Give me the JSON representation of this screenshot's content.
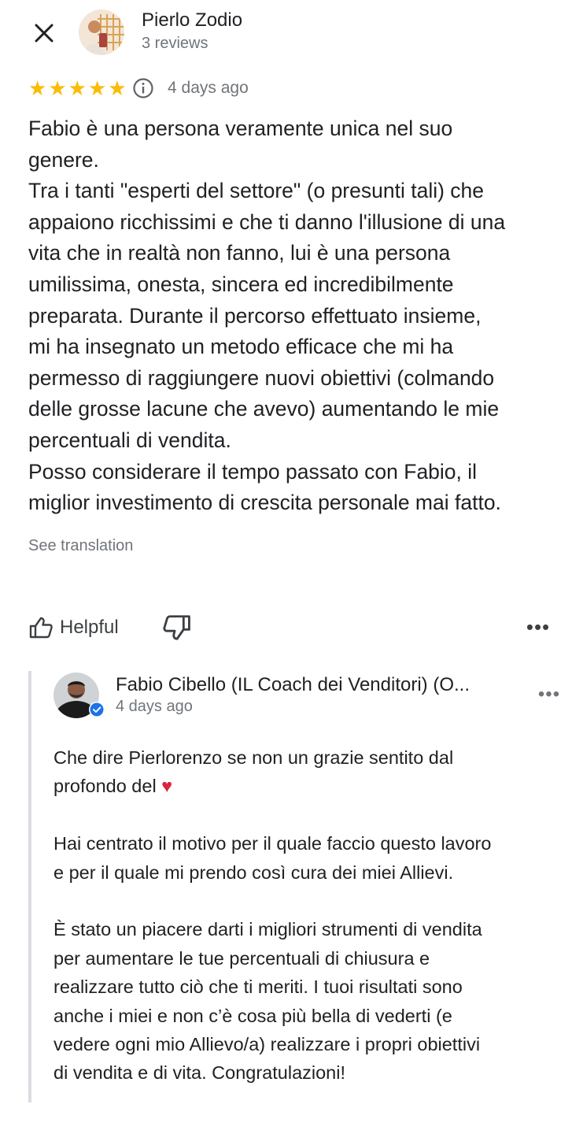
{
  "header": {
    "close_icon": "close-icon",
    "reviewer_name": "Pierlo Zodio",
    "reviewer_reviews": "3 reviews"
  },
  "review": {
    "rating": 5,
    "rating_max": 5,
    "star_color": "#fbbc04",
    "date": "4 days ago",
    "text": "Fabio è una persona veramente unica nel suo\ngenere.\nTra i tanti \"esperti del settore\" (o presunti tali) che\nappaiono ricchissimi e che ti danno l'illusione di una\nvita che in realtà non fanno, lui è una persona\numilissima, onesta, sincera ed incredibilmente\npreparata. Durante il percorso effettuato insieme,\nmi ha insegnato un metodo efficace che mi ha\npermesso di raggiungere nuovi obiettivi (colmando\ndelle grosse lacune che avevo) aumentando le mie\npercentuali di vendita.\nPosso considerare il tempo passato con Fabio, il\nmiglior investimento di crescita personale mai fatto.",
    "see_translation": "See translation"
  },
  "actions": {
    "helpful_label": "Helpful",
    "helpful_icon": "thumbs-up-icon",
    "not_helpful_icon": "thumbs-down-icon",
    "more_icon": "more-horiz-icon"
  },
  "owner_reply": {
    "name": "Fabio Cibello (IL Coach dei Venditori) (O...",
    "date": "4 days ago",
    "verified_icon": "verified-check-icon",
    "verified_color": "#1a73e8",
    "text_before_heart": "Che dire Pierlorenzo se non un grazie sentito dal\nprofondo del ",
    "heart": "♥",
    "text_after_heart": "\n\nHai centrato il motivo per il quale faccio questo lavoro\ne per il quale mi prendo così cura dei miei Allievi.\n\nÈ stato un piacere darti i migliori strumenti di vendita\nper aumentare le tue percentuali di chiusura e\nrealizzare tutto ciò che ti meriti. I tuoi risultati sono\nanche i miei e non c’è cosa più bella di vederti (e\nvedere ogni mio Allievo/a) realizzare i propri obiettivi\ndi vendita e di vita. Congratulazioni!"
  }
}
